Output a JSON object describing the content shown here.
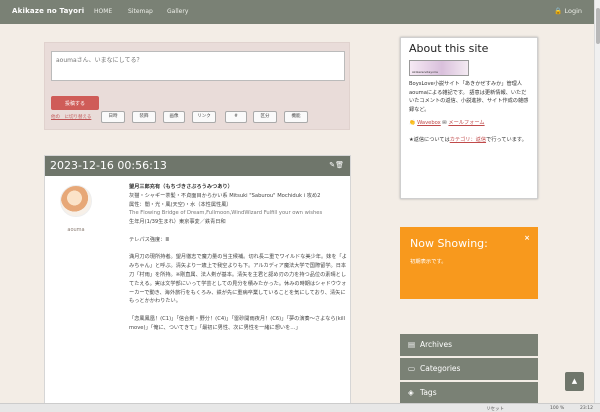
{
  "nav": {
    "brand": "Akikaze no Tayori",
    "links": [
      "HOME",
      "Sitemap",
      "Gallery"
    ],
    "login": "🔒 Login"
  },
  "form": {
    "placeholder": "aoumaさん、いまなにしてる？",
    "post_label": "投稿する",
    "mode_link": "他の　に切り替える",
    "tools": [
      "日時",
      "装飾",
      "画像",
      "リンク",
      "#",
      "区分",
      "機能"
    ]
  },
  "entry": {
    "date": "2023-12-16 00:56:13",
    "icons": "✎🗑",
    "author": "aouma",
    "lines": [
      "望月三郎充有（もちづきさぶろうみつあり）",
      "灰猫・シャギー茶髪・不貞面目からかい系 Mitsuki \"Saburou\" Mochiduk i  攻め2",
      "属性：闇・光・風(天空)・水（本性属性風）",
      "The Flowing Bridge of Dream,Fullmoon,WindWizard Fulfill your own wishes",
      "生年月(1/39生まれ）東京事変／鉄青日和",
      "テレパス強度：Ⅲ",
      "満月刀の現所持者。望月徹志で魔力量の当主候補。切れ長二重でワイルドな美少年。妹を「よみちゃん」と呼ぶ。清矢より一歳上で我空よりも下。アルカディア魔法大学で国際留学。日本刀「村雨」を所持。※剛直属、法人剣が基本。清矢を主君と認め刃の力を持つ品位の素晴としてたえる。実は文学部にいって学芸としての見分を積みたかった。休みの時期はシャドウウォーカーで動き、海外旅行をもくろみ、鉄が先に重病卒業していることを気にしており、清矢にもっとかかわりたい。",
      "「恋風鳳凰！(C1)」「信合剣・野分！(C4)」「雷砂開雨夜月！(C6)」「夢の演奏～さよなら(kill move)」「俺に、ついてきて」「最初に男性、次に男性を一緒に想いを…」"
    ]
  },
  "about": {
    "title": "About this site",
    "banner_text": "Akikazenotayoria",
    "desc": "BoysLove小説サイト「あきかぜすみか」管理人aoumaによる雑記です。 語意は更新情報、いただいたコメントの返信、小説進捗、サイト作成の雑感録など。",
    "wavebox": "Wavebox",
    "mailform": "メールフォーム",
    "reply_pre": "★返信については",
    "reply_link": "カテゴリ：返信",
    "reply_post": "で行っています。"
  },
  "now": {
    "title": "Now Showing:",
    "close": "×",
    "msg": "初期表示です。"
  },
  "sidebar": {
    "archives": "Archives",
    "categories": "Categories",
    "tags": "Tags"
  },
  "status": {
    "label": "リセット",
    "zoom": "100 %",
    "time": "23:12"
  },
  "colors": {
    "nav": "#7a8175",
    "post_button": "#cf5c58",
    "now_showing": "#f8991d"
  }
}
